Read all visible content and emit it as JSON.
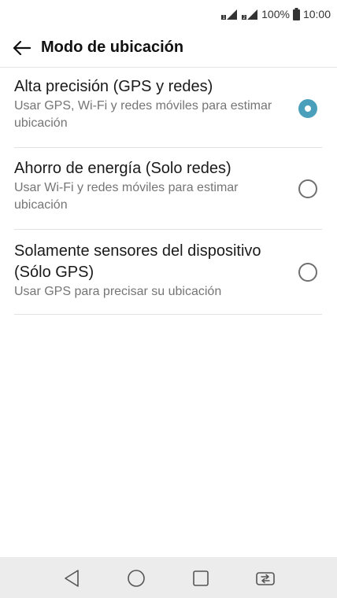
{
  "status_bar": {
    "battery": "100%",
    "time": "10:00"
  },
  "header": {
    "title": "Modo de ubicación"
  },
  "options": [
    {
      "title": "Alta precisión (GPS y redes)",
      "subtitle": "Usar GPS, Wi-Fi y redes móviles para estimar ubicación",
      "selected": true
    },
    {
      "title": "Ahorro de energía (Solo redes)",
      "subtitle": "Usar Wi-Fi y redes móviles para estimar ubicación",
      "selected": false
    },
    {
      "title": "Solamente sensores del dispositivo (Sólo GPS)",
      "subtitle": "Usar GPS para precisar su ubicación",
      "selected": false
    }
  ],
  "colors": {
    "accent": "#4aa0bb",
    "nav_bar": "#ececec"
  },
  "icons": {
    "back": "arrow-left",
    "nav_back": "triangle-left",
    "nav_home": "circle",
    "nav_recents": "square",
    "nav_switch": "dual-window-switch"
  }
}
